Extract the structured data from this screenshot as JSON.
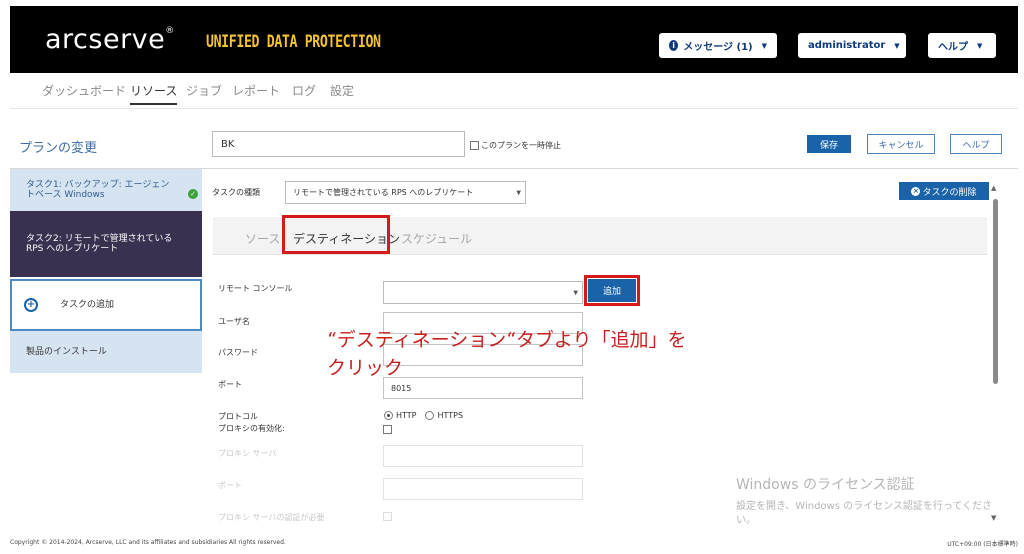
{
  "header": {
    "logo": "arcserve",
    "logo_mark": "®",
    "product": "UNIFIED DATA PROTECTION",
    "messages_label": "メッセージ (1)",
    "user_label": "administrator",
    "help_label": "ヘルプ"
  },
  "nav": {
    "items": [
      {
        "label": "ダッシュボード"
      },
      {
        "label": "リソース"
      },
      {
        "label": "ジョブ"
      },
      {
        "label": "レポート"
      },
      {
        "label": "ログ"
      },
      {
        "label": "設定"
      }
    ],
    "active": "リソース"
  },
  "page": {
    "title": "プランの変更",
    "plan_name_value": "BK",
    "pause_label": "このプランを一時停止",
    "save_label": "保存",
    "cancel_label": "キャンセル",
    "help_label": "ヘルプ"
  },
  "sidebar": {
    "items": [
      {
        "label": "タスク1: バックアップ: エージェントベース Windows"
      },
      {
        "label": "タスク2: リモートで管理されている RPS へのレプリケート"
      },
      {
        "label": "タスクの追加"
      },
      {
        "label": "製品のインストール"
      }
    ]
  },
  "task": {
    "type_label": "タスクの種類",
    "type_value": "リモートで管理されている RPS へのレプリケート",
    "delete_label": "タスクの削除",
    "tabs": [
      {
        "label": "ソース"
      },
      {
        "label": "デスティネーション"
      },
      {
        "label": "スケジュール"
      }
    ],
    "active_tab": "デスティネーション"
  },
  "form": {
    "remote_console_label": "リモート コンソール",
    "add_label": "追加",
    "username_label": "ユーザ名",
    "password_label": "パスワード",
    "port_label": "ポート",
    "port_value": "8015",
    "protocol_label": "プロトコル",
    "protocol_http": "HTTP",
    "protocol_https": "HTTPS",
    "protocol_selected": "HTTP",
    "proxy_enable_label": "プロキシの有効化:",
    "proxy_server_label": "プロキシ サーバ",
    "proxy_port_label": "ポート",
    "proxy_auth_label": "プロキシ サーバの認証が必要"
  },
  "annotation": {
    "line1": "“デスティネーション“タブより「追加」を",
    "line2": "クリック"
  },
  "watermark": {
    "title": "Windows のライセンス認証",
    "sub": "設定を開き、Windows のライセンス認証を行ってください。"
  },
  "footer": {
    "copyright": "Copyright © 2014-2024, Arcserve, LLC and its affiliates and subsidiaries All rights reserved.",
    "timezone": "UTC+09:00 (日本標準時)"
  },
  "colors": {
    "accent": "#1a63a8",
    "highlight": "#d41a1a",
    "brand_yellow": "#f2c232"
  },
  "icons": [
    "info-icon",
    "chevron-down-icon",
    "check-icon",
    "plus-icon",
    "close-circle-icon",
    "scroll-up-icon",
    "scroll-down-icon"
  ]
}
